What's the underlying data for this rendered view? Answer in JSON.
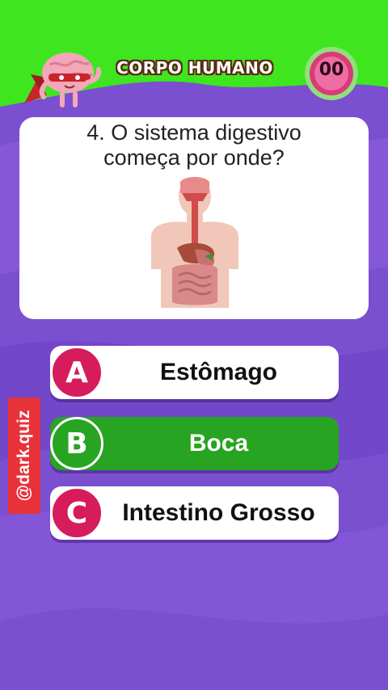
{
  "header": {
    "title": "CORPO HUMANO",
    "timer": "00"
  },
  "question": {
    "line1": "4. O sistema digestivo",
    "line2": "começa por onde?"
  },
  "answers": [
    {
      "letter": "A",
      "label": "Estômago",
      "state": "default"
    },
    {
      "letter": "B",
      "label": "Boca",
      "state": "correct"
    },
    {
      "letter": "C",
      "label": "Intestino Grosso",
      "state": "default"
    }
  ],
  "watermark": {
    "handle": "@dark.quiz"
  },
  "icons": {
    "mascot": "brain-superhero-icon",
    "timer": "timer-icon",
    "illustration": "digestive-system-icon"
  },
  "colors": {
    "header_bg": "#3fe51f",
    "background": "#7a4fd0",
    "badge": "#d61c5c",
    "correct": "#27a421",
    "watermark": "#e8323a"
  }
}
